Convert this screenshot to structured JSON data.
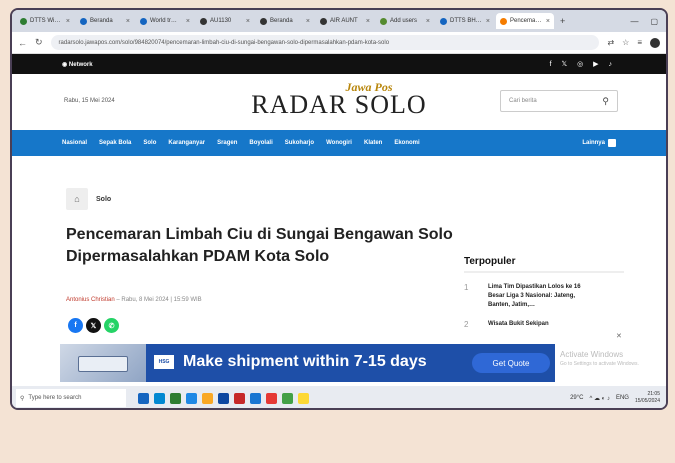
{
  "browser": {
    "tabs": [
      {
        "label": "DTTS Wi…",
        "color": "#2e7d32"
      },
      {
        "label": "Beranda",
        "color": "#1565c0"
      },
      {
        "label": "World tr…",
        "color": "#1565c0"
      },
      {
        "label": "AU1130",
        "color": "#333333"
      },
      {
        "label": "Beranda",
        "color": "#333333"
      },
      {
        "label": "AIR AUNT",
        "color": "#333333"
      },
      {
        "label": "Add users",
        "color": "#558b2f"
      },
      {
        "label": "DTTS BH…",
        "color": "#1565c0"
      },
      {
        "label": "Pencema…",
        "color": "#f57c00",
        "active": true
      }
    ],
    "url": "radarsolo.jawapos.com/solo/984820074/pencemaran-limbah-ciu-di-sungai-bengawan-solo-dipermasalahkan-pdam-kota-solo"
  },
  "site": {
    "network_label": "Network",
    "date": "Rabu, 15 Mei 2024",
    "logo_top": "Jawa Pos",
    "logo_main": "RADAR SOLO",
    "search_placeholder": "Cari berita",
    "nav_items": [
      "Nasional",
      "Sepak Bola",
      "Solo",
      "Karanganyar",
      "Sragen",
      "Boyolali",
      "Sukoharjo",
      "Wonogiri",
      "Klaten",
      "Ekonomi"
    ],
    "nav_more": "Lainnya"
  },
  "article": {
    "breadcrumb": "Solo",
    "title": "Pencemaran Limbah Ciu di Sungai Bengawan Solo Dipermasalahkan PDAM Kota Solo",
    "author": "Antonius Christian",
    "date": "– Rabu, 8 Mei 2024 | 15:59 WIB"
  },
  "popular": {
    "heading": "Terpopuler",
    "items": [
      {
        "num": "1",
        "text": "Lima Tim Dipastikan Lolos ke 16 Besar Liga 3 Nasional: Jateng, Banten, Jatim,…"
      },
      {
        "num": "2",
        "text": "Wisata Bukit Sekipan"
      }
    ]
  },
  "ad": {
    "logo": "HSG",
    "text": "Make shipment within 7-15 days",
    "button": "Get Quote"
  },
  "watermark": {
    "title": "Activate Windows",
    "sub": "Go to Settings to activate Windows."
  },
  "taskbar": {
    "search_placeholder": "Type here to search",
    "weather": "29°C",
    "lang": "ENG",
    "time": "21:05",
    "date": "15/05/2024",
    "icon_colors": [
      "#1565c0",
      "#0288d1",
      "#2e7d32",
      "#1e88e5",
      "#f9a825",
      "#0d47a1",
      "#c62828",
      "#1976d2",
      "#e53935",
      "#43a047",
      "#fdd835"
    ]
  }
}
